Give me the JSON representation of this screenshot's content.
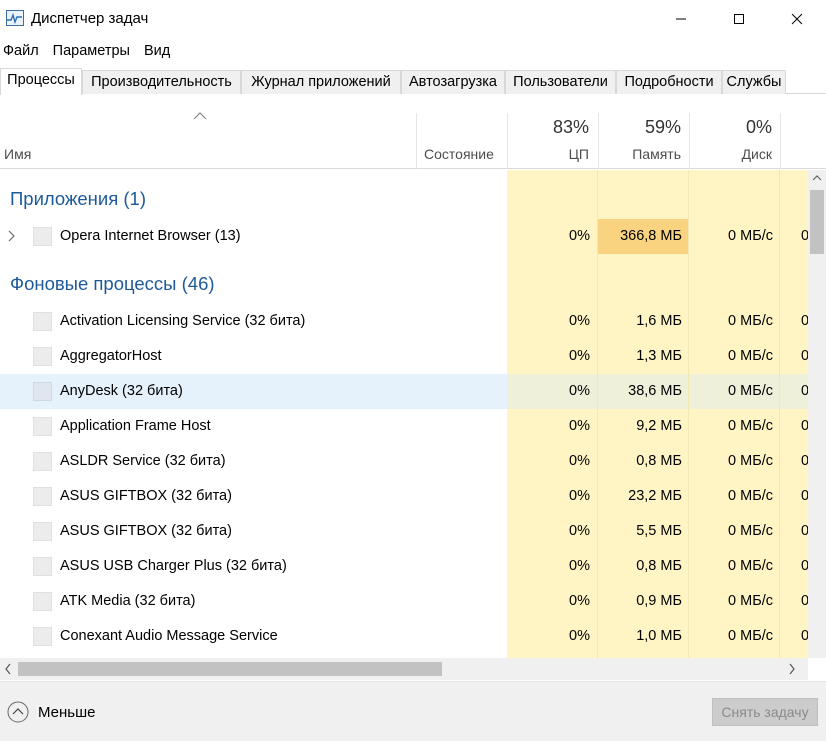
{
  "window": {
    "title": "Диспетчер задач"
  },
  "menu": [
    "Файл",
    "Параметры",
    "Вид"
  ],
  "tabs": [
    "Процессы",
    "Производительность",
    "Журнал приложений",
    "Автозагрузка",
    "Пользователи",
    "Подробности",
    "Службы"
  ],
  "active_tab": "Процессы",
  "columns": {
    "name": "Имя",
    "state": "Состояние",
    "cpu": {
      "pct": "83%",
      "label": "ЦП"
    },
    "memory": {
      "pct": "59%",
      "label": "Память"
    },
    "disk": {
      "pct": "0%",
      "label": "Диск"
    }
  },
  "groups": {
    "apps": "Приложения (1)",
    "background": "Фоновые процессы (46)"
  },
  "apps": [
    {
      "name": "Opera Internet Browser (13)",
      "cpu": "0%",
      "mem": "366,8 МБ",
      "disk": "0 МБ/с",
      "net": "0",
      "expandable": true,
      "mem_highlight": true
    }
  ],
  "processes": [
    {
      "name": "Activation Licensing Service (32 бита)",
      "cpu": "0%",
      "mem": "1,6 МБ",
      "disk": "0 МБ/с",
      "net": "0"
    },
    {
      "name": "AggregatorHost",
      "cpu": "0%",
      "mem": "1,3 МБ",
      "disk": "0 МБ/с",
      "net": "0"
    },
    {
      "name": "AnyDesk (32 бита)",
      "cpu": "0%",
      "mem": "38,6 МБ",
      "disk": "0 МБ/с",
      "net": "0",
      "selected": true
    },
    {
      "name": "Application Frame Host",
      "cpu": "0%",
      "mem": "9,2 МБ",
      "disk": "0 МБ/с",
      "net": "0"
    },
    {
      "name": "ASLDR Service (32 бита)",
      "cpu": "0%",
      "mem": "0,8 МБ",
      "disk": "0 МБ/с",
      "net": "0"
    },
    {
      "name": "ASUS GIFTBOX (32 бита)",
      "cpu": "0%",
      "mem": "23,2 МБ",
      "disk": "0 МБ/с",
      "net": "0"
    },
    {
      "name": "ASUS GIFTBOX (32 бита)",
      "cpu": "0%",
      "mem": "5,5 МБ",
      "disk": "0 МБ/с",
      "net": "0"
    },
    {
      "name": "ASUS USB Charger Plus (32 бита)",
      "cpu": "0%",
      "mem": "0,8 МБ",
      "disk": "0 МБ/с",
      "net": "0"
    },
    {
      "name": "ATK Media (32 бита)",
      "cpu": "0%",
      "mem": "0,9 МБ",
      "disk": "0 МБ/с",
      "net": "0"
    },
    {
      "name": "Conexant Audio Message Service",
      "cpu": "0%",
      "mem": "1,0 МБ",
      "disk": "0 МБ/с",
      "net": "0"
    }
  ],
  "footer": {
    "less": "Меньше",
    "end_task": "Снять задачу"
  },
  "colors": {
    "group_text": "#1e5a99",
    "heat_light": "#fff4c4",
    "heat_strong": "#f9d37f",
    "selection": "#e5f1fb"
  }
}
